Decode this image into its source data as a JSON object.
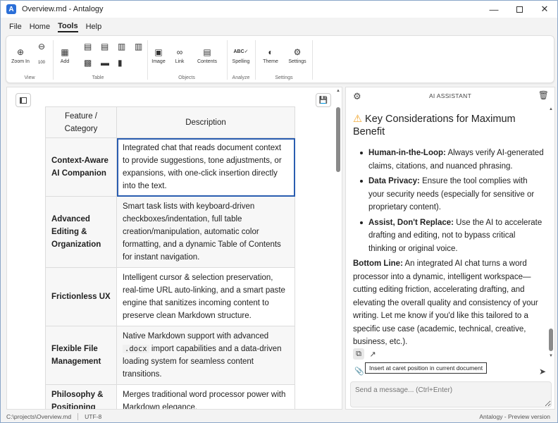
{
  "window": {
    "title": "Overview.md - Antalogy",
    "app_icon_letter": "A"
  },
  "menu": [
    "File",
    "Home",
    "Tools",
    "Help"
  ],
  "ribbon": {
    "groups": {
      "view": "View",
      "table": "Table",
      "objects": "Objects",
      "analyze": "Analyze",
      "settings": "Settings"
    },
    "buttons": {
      "zoom_in": "Zoom In",
      "add": "Add",
      "image": "Image",
      "link": "Link",
      "contents": "Contents",
      "spelling": "Spelling",
      "theme": "Theme",
      "settings": "Settings"
    },
    "zoom_reset": "100"
  },
  "table": {
    "headers": [
      "Feature / Category",
      "Description"
    ],
    "rows": [
      {
        "feature": "Context-Aware AI Companion",
        "description": "Integrated chat that reads document context to provide suggestions, tone adjustments, or expansions, with one-click insertion directly into the text."
      },
      {
        "feature": "Advanced Editing & Organization",
        "description": "Smart task lists with keyboard-driven checkboxes/indentation, full table creation/manipulation, automatic color formatting, and a dynamic Table of Contents for instant navigation."
      },
      {
        "feature": "Frictionless UX",
        "description": "Intelligent cursor & selection preservation, real-time URL auto-linking, and a smart paste engine that sanitizes incoming content to preserve clean Markdown structure."
      },
      {
        "feature": "Flexible File Management",
        "description_before": "Native Markdown support with advanced",
        "description_code": ".docx",
        "description_after": "import capabilities and a data-driven loading system for seamless content transitions."
      },
      {
        "feature": "Philosophy & Positioning",
        "description": "Merges traditional word processor power with Markdown elegance."
      }
    ]
  },
  "ai": {
    "title": "AI ASSISTANT",
    "heading": "Key Considerations for Maximum Benefit",
    "items": [
      {
        "label": "Human-in-the-Loop:",
        "text": "Always verify AI-generated claims, citations, and nuanced phrasing."
      },
      {
        "label": "Data Privacy:",
        "text": "Ensure the tool complies with your security needs (especially for sensitive or proprietary content)."
      },
      {
        "label": "Assist, Don't Replace:",
        "text": "Use the AI to accelerate drafting and editing, not to bypass critical thinking or original voice."
      }
    ],
    "bottom_label": "Bottom Line:",
    "bottom_text": "An integrated AI chat turns a word processor into a dynamic, intelligent workspace—cutting editing friction, accelerating drafting, and elevating the overall quality and consistency of your writing. Let me know if you'd like this tailored to a specific use case (academic, technical, creative, business, etc.).",
    "tooltip": "Insert at caret position in current document",
    "input_placeholder": "Send a message... (Ctrl+Enter)"
  },
  "status": {
    "path": "C:\\projects\\Overview.md",
    "encoding": "UTF-8",
    "right": "Antalogy - Preview version"
  }
}
